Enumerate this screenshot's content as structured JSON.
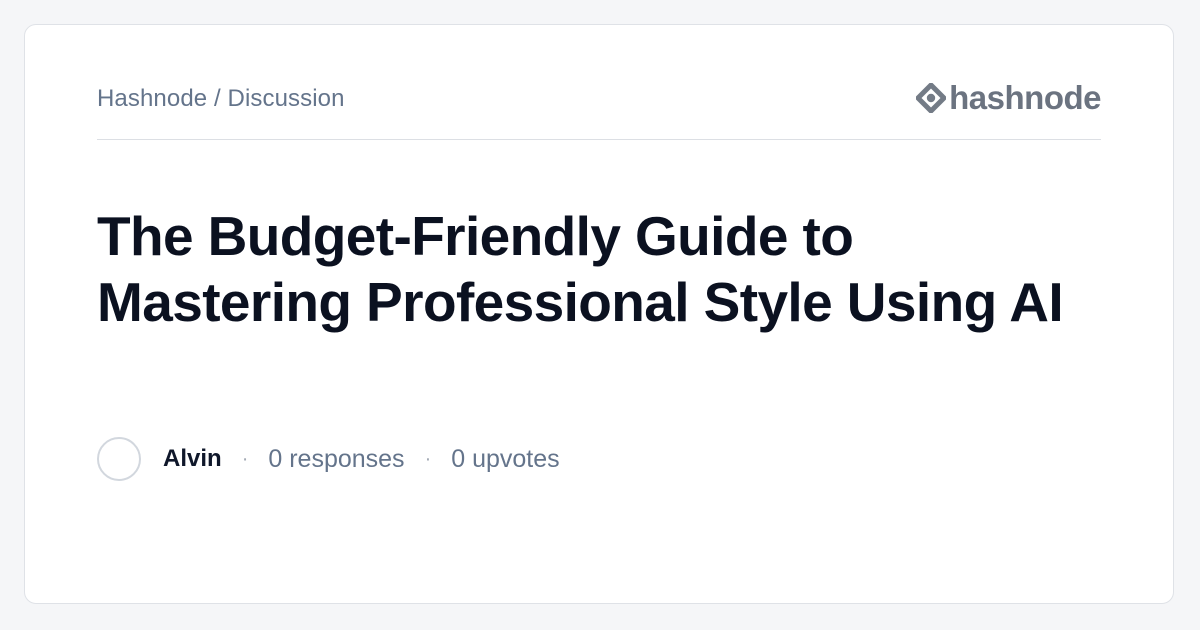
{
  "breadcrumb": "Hashnode / Discussion",
  "brand": {
    "name": "hashnode",
    "icon": "hashnode-logo-icon"
  },
  "post": {
    "title": "The Budget-Friendly  Guide to Mastering Professional  Style Using AI"
  },
  "meta": {
    "author": "Alvin",
    "separator": "·",
    "responses": "0 responses",
    "upvotes": "0 upvotes"
  },
  "colors": {
    "title": "#0b1120",
    "muted": "#64748b",
    "brand": "#6b7380",
    "border": "#dfe2e7"
  }
}
